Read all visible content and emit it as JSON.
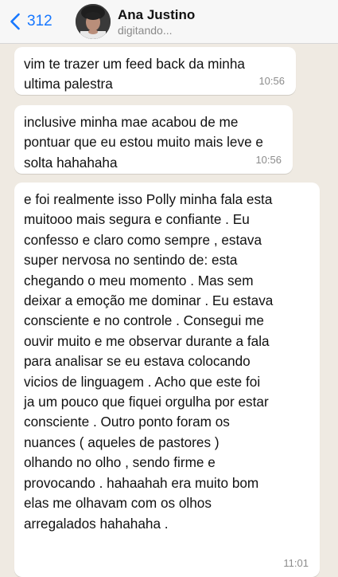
{
  "header": {
    "back_count": "312",
    "contact_name": "Ana Justino",
    "status": "digitando...",
    "accent_color": "#1677ff",
    "back_icon": "chevron-left-icon",
    "avatar": "contact-avatar-photo"
  },
  "chat": {
    "background_color": "#efeae2",
    "bubble_color": "#ffffff",
    "messages": [
      {
        "text": "vim te trazer um feed back da minha\nultima palestra",
        "time": "10:56"
      },
      {
        "text": "inclusive minha mae acabou de me\npontuar que eu estou muito mais leve e\nsolta hahahaha",
        "time": "10:56"
      },
      {
        "text": "e foi realmente isso Polly minha fala esta\nmuitooo mais segura e confiante . Eu\nconfesso e claro como sempre , estava\nsuper nervosa no sentindo de:  esta\nchegando o meu momento . Mas sem\ndeixar a emoção me dominar . Eu estava\nconsciente e no controle . Consegui me\nouvir muito e me observar durante a fala\npara analisar se eu estava colocando\nvicios de linguagem . Acho que este foi\nja um pouco que fiquei orgulha por estar\nconsciente . Outro ponto foram os\nnuances ( aqueles de pastores )\nolhando no olho , sendo firme e\nprovocando . hahaahah era muito bom\nelas me olhavam com os olhos\narregalados hahahaha .",
        "time": "11:01"
      }
    ]
  }
}
